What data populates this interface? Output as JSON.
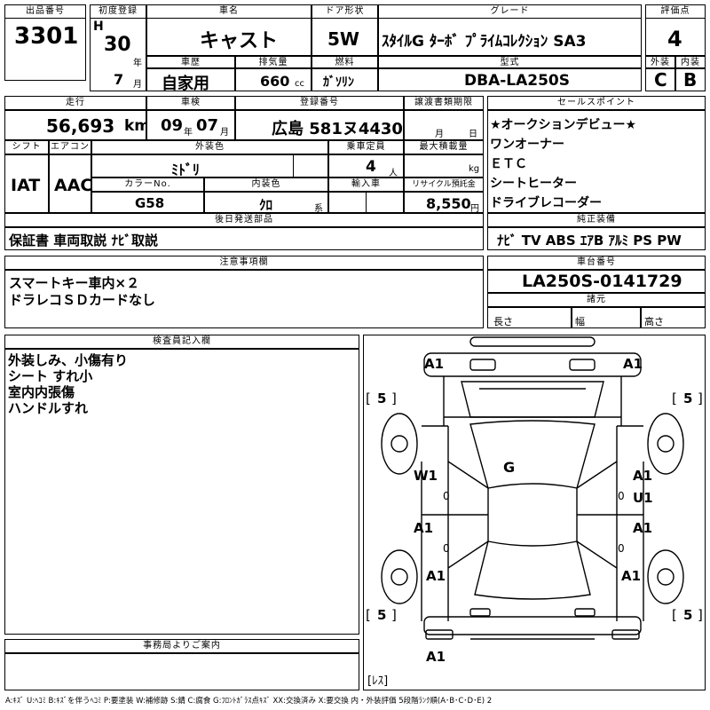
{
  "header": {
    "lot_label": "出品番号",
    "lot": "3301",
    "first_reg_label": "初度登録",
    "era": "H",
    "year": "30",
    "year_unit": "年",
    "month": "7",
    "month_unit": "月",
    "car_name_label": "車名",
    "car_name": "キャスト",
    "door_label": "ドア形状",
    "door": "5W",
    "grade_label": "グレード",
    "grade": "ｽﾀｲﾙG ﾀｰﾎﾞ ﾌﾟﾗｲﾑｺﾚｸｼｮﾝ SA3",
    "score_label": "評価点",
    "score": "4",
    "history_label": "車歴",
    "history": "自家用",
    "displacement_label": "排気量",
    "displacement": "660",
    "displacement_unit": "cc",
    "fuel_label": "燃料",
    "fuel": "ｶﾞｿﾘﾝ",
    "model_label": "型式",
    "model": "DBA-LA250S",
    "exterior_label": "外装",
    "exterior": "C",
    "interior_label": "内装",
    "interior": "B"
  },
  "details": {
    "mileage_label": "走行",
    "mileage": "56,693",
    "mileage_unit": "km",
    "inspection_label": "車検",
    "insp_year": "09",
    "insp_year_unit": "年",
    "insp_month": "07",
    "insp_month_unit": "月",
    "plate_label": "登録番号",
    "plate": "広島 581ヌ4430",
    "transfer_label": "譲渡書類期限",
    "transfer_month_unit": "月",
    "transfer_day_unit": "日",
    "shift_label": "シフト",
    "shift": "IAT",
    "ac_label": "エアコン",
    "ac": "AAC",
    "ext_color_label": "外装色",
    "ext_color": "ﾐﾄﾞﾘ",
    "capacity_label": "乗車定員",
    "capacity": "4",
    "capacity_unit": "人",
    "max_load_label": "最大積載量",
    "max_load_unit": "kg",
    "color_no_label": "カラーNo.",
    "color_no": "G58",
    "int_color_label": "内装色",
    "int_color": "ｸﾛ",
    "int_color_unit": "系",
    "import_label": "輸入車",
    "recycle_label": "リサイクル預託金",
    "recycle": "8,550",
    "recycle_unit": "円",
    "post_parts_label": "後日発送部品",
    "post_parts": "保証書 車両取説 ﾅﾋﾞ取説"
  },
  "sales": {
    "label": "セールスポイント",
    "points": [
      "★オークションデビュー★",
      "ワンオーナー",
      "ＥＴＣ",
      "シートヒーター",
      "ドライブレコーダー"
    ],
    "equip_label": "純正装備",
    "equipment": "ﾅﾋﾞ TV ABS ｴｱB ｱﾙﾐ PS PW"
  },
  "notes": {
    "label": "注意事項欄",
    "lines": [
      "スマートキー車内×２",
      "ドラレコＳＤカードなし"
    ]
  },
  "chassis": {
    "label": "車台番号",
    "number": "LA250S-0141729",
    "dims_label": "諸元",
    "length_label": "長さ",
    "width_label": "幅",
    "height_label": "高さ"
  },
  "inspector": {
    "label": "検査員記入欄",
    "lines": [
      "外装しみ、小傷有り",
      "シート すれ小",
      "室内内張傷",
      "ハンドルすれ"
    ]
  },
  "diagram": {
    "marks": {
      "a1_tl": "A1",
      "a1_tr": "A1",
      "g_center": "G",
      "w1_left": "W1",
      "zero_l1": "0",
      "a1_r1": "A1",
      "u1_r1": "U1",
      "zero_r1": "0",
      "a1_l2": "A1",
      "zero_l2": "0",
      "a1_r2": "A1",
      "zero_r2": "0",
      "a1_tire_l": "A1",
      "a1_tire_r": "A1",
      "a1_bottom": "A1"
    },
    "tires": {
      "fl": "5",
      "fr": "5",
      "rl": "5",
      "rr": "5",
      "bracket_open": "[",
      "bracket_close": "]"
    },
    "spare_label": "[ﾚｽ]"
  },
  "office": {
    "label": "事務局よりご案内"
  },
  "legend": "A:ｷｽﾞ U:ﾍｺﾐ B:ｷｽﾞを伴うﾍｺﾐ P:要塗装 W:補修跡 S:錆 C:腐食 G:ﾌﾛﾝﾄｶﾞﾗｽ点ｷｽﾞ XX:交換済み X:要交換 内・外装評価 5段階ﾗﾝｸ順(A･B･C･D･E) 2"
}
